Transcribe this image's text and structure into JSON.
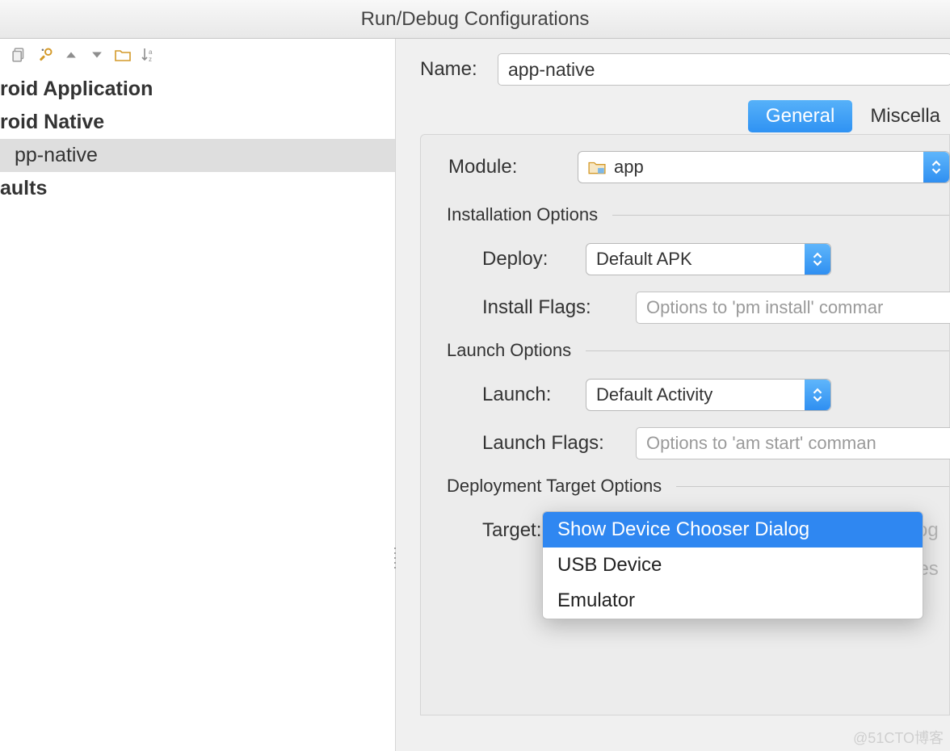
{
  "window": {
    "title": "Run/Debug Configurations"
  },
  "sidebar": {
    "items": [
      {
        "label": "roid Application"
      },
      {
        "label": "roid Native"
      },
      {
        "label": "pp-native",
        "selected": true
      },
      {
        "label": "aults"
      }
    ]
  },
  "name_field": {
    "label": "Name:",
    "value": "app-native"
  },
  "tabs": [
    {
      "label": "General",
      "active": true
    },
    {
      "label": "Miscella"
    }
  ],
  "module": {
    "label": "Module:",
    "value": "app"
  },
  "installation": {
    "heading": "Installation Options",
    "deploy_label": "Deploy:",
    "deploy_value": "Default APK",
    "flags_label": "Install Flags:",
    "flags_placeholder": "Options to 'pm install' commar"
  },
  "launch": {
    "heading": "Launch Options",
    "launch_label": "Launch:",
    "launch_value": "Default Activity",
    "flags_label": "Launch Flags:",
    "flags_placeholder": "Options to 'am start' comman"
  },
  "deployment": {
    "heading": "Deployment Target Options",
    "target_label": "Target:",
    "behind_text": "og",
    "future_label": "e for future launches",
    "options": [
      {
        "label": "Show Device Chooser Dialog",
        "active": true
      },
      {
        "label": "USB Device"
      },
      {
        "label": "Emulator"
      }
    ]
  },
  "watermark": "@51CTO博客"
}
